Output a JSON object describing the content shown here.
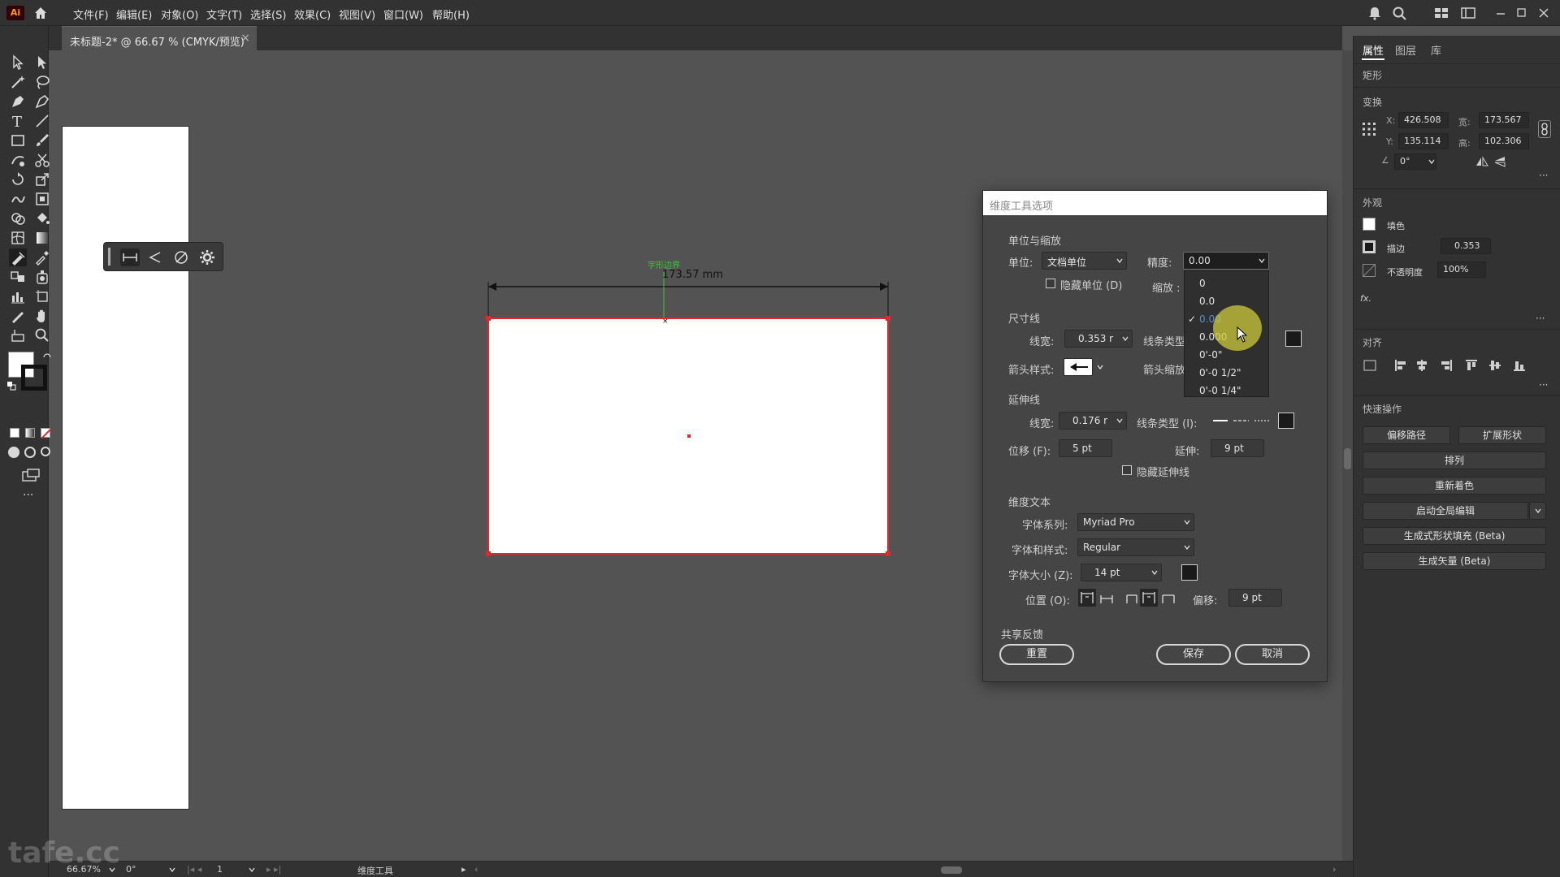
{
  "app": {
    "logo": "Ai",
    "menu": [
      "文件(F)",
      "编辑(E)",
      "对象(O)",
      "文字(T)",
      "选择(S)",
      "效果(C)",
      "视图(V)",
      "窗口(W)",
      "帮助(H)"
    ]
  },
  "document": {
    "tab_title": "未标题-2* @ 66.67 % (CMYK/预览)",
    "close_glyph": "×"
  },
  "canvas": {
    "measurement_label": "173.57 mm",
    "smart_guide_label": "字形边界"
  },
  "dialog": {
    "title": "维度工具选项",
    "units_section": "单位与缩放",
    "unit_label": "单位:",
    "unit_value": "文档单位",
    "precision_label": "精度:",
    "precision_value": "0.00",
    "hide_units_label": "隐藏单位 (D)",
    "scale_label": "缩放 :",
    "dimension_line_section": "尺寸线",
    "line_width_label": "线宽:",
    "line_width_value": "0.353 r",
    "line_type_label": "线条类型",
    "arrow_style_label": "箭头样式:",
    "arrow_scale_label": "箭头缩放",
    "extension_section": "延伸线",
    "ext_width_label": "线宽:",
    "ext_width_value": "0.176 r",
    "ext_line_type_label": "线条类型 (I):",
    "offset_label": "位移 (F):",
    "offset_value": "5 pt",
    "extend_label": "延伸:",
    "extend_value": "9 pt",
    "hide_ext_label": "隐藏延伸线",
    "text_section": "维度文本",
    "font_family_label": "字体系列:",
    "font_family_value": "Myriad Pro",
    "font_style_label": "字体和样式:",
    "font_style_value": "Regular",
    "font_size_label": "字体大小 (Z):",
    "font_size_value": "14 pt",
    "position_label": "位置 (O):",
    "text_offset_label": "偏移:",
    "text_offset_value": "9 pt",
    "feedback_label": "共享反馈",
    "reset_button": "重置",
    "save_button": "保存",
    "cancel_button": "取消",
    "precision_options": [
      "0",
      "0.0",
      "0.00",
      "0.000",
      "0'-0\"",
      "0'-0 1/2\"",
      "0'-0 1/4\""
    ],
    "precision_selected_index": 2,
    "precision_hover_index": 3
  },
  "properties": {
    "tabs": [
      "属性",
      "图层",
      "库"
    ],
    "object_type": "矩形",
    "transform_section": "变换",
    "x_label": "X:",
    "x_value": "426.508",
    "y_label": "Y:",
    "y_value": "135.114",
    "w_label": "宽:",
    "w_value": "173.567",
    "h_label": "高:",
    "h_value": "102.306",
    "angle_value": "0°",
    "appearance_section": "外观",
    "fill_label": "填色",
    "stroke_label": "描边",
    "stroke_value": "0.353",
    "opacity_label": "不透明度",
    "opacity_value": "100%",
    "fx_label": "fx.",
    "align_section": "对齐",
    "quick_actions_section": "快速操作",
    "offset_path_button": "偏移路径",
    "expand_shape_button": "扩展形状",
    "arrange_button": "排列",
    "recolor_button": "重新着色",
    "global_edit_button": "启动全局编辑",
    "gen_shape_fill_button": "生成式形状填充 (Beta)",
    "gen_vector_button": "生成矢量 (Beta)"
  },
  "statusbar": {
    "zoom": "66.67%",
    "rotation": "0°",
    "artboard_number": "1",
    "current_tool": "维度工具"
  },
  "watermark": "tafe.cc",
  "colors": {
    "accent_red": "#e0282f",
    "guide_green": "#37c837",
    "check_blue": "#4a90e2",
    "halo_yellow": "#cecA3c"
  }
}
